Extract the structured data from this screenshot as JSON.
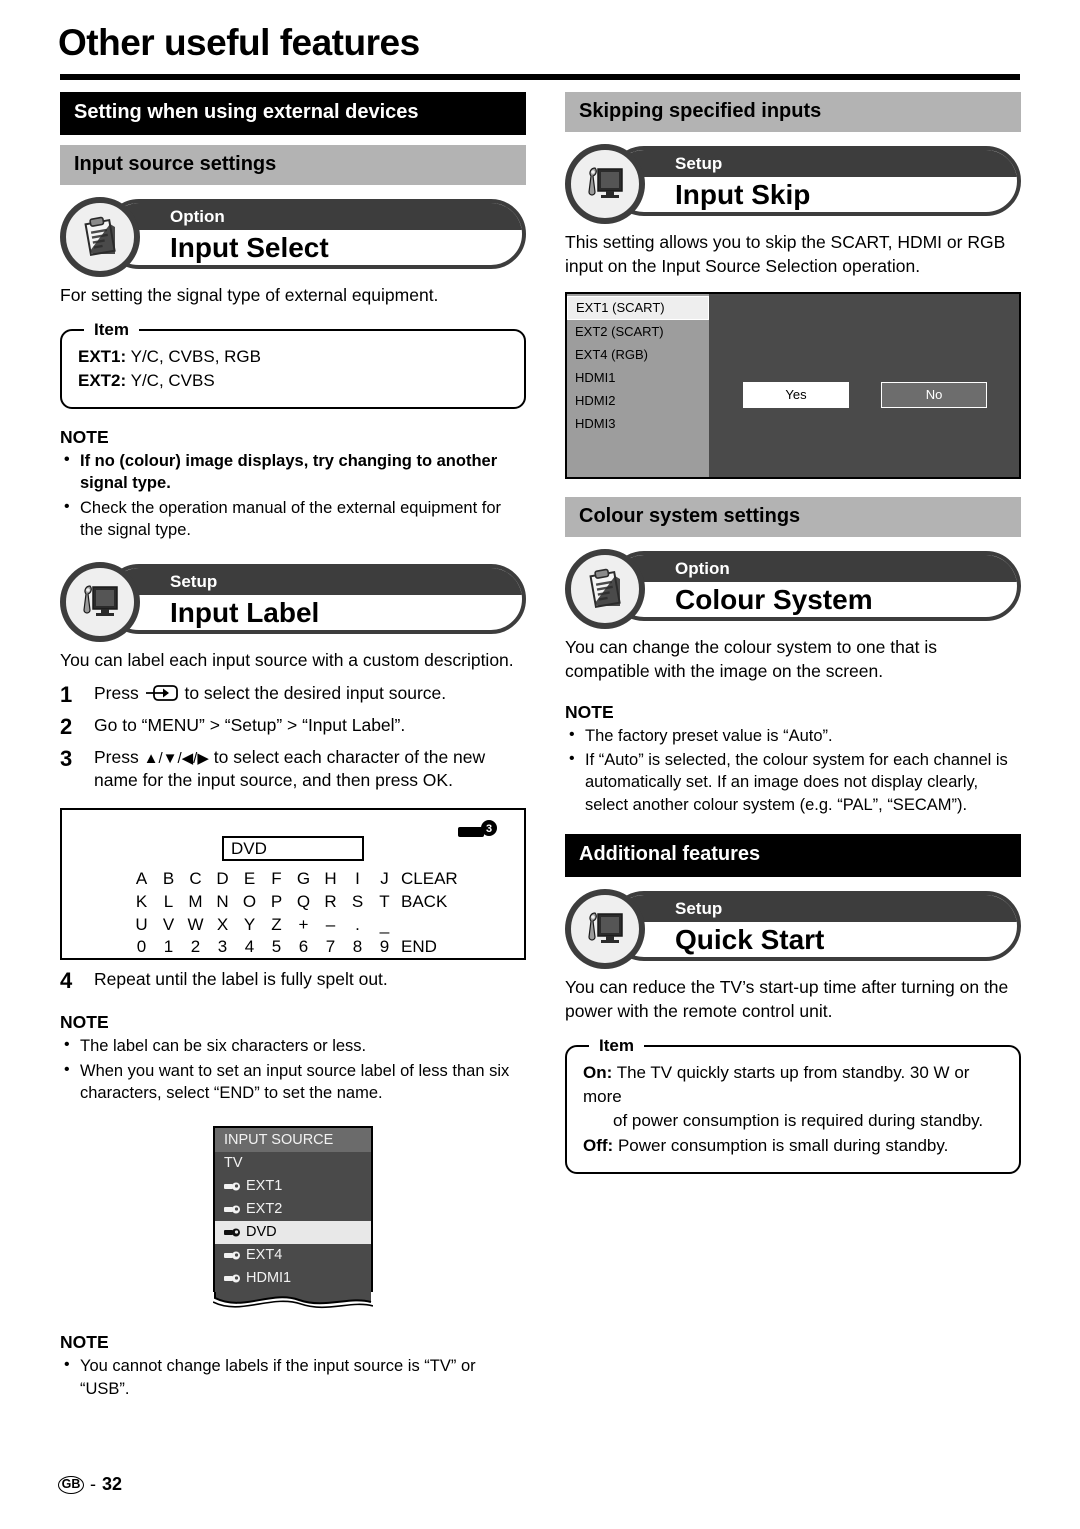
{
  "page": {
    "title": "Other useful features",
    "footer_region": "GB",
    "footer_dash": "-",
    "footer_number": "32"
  },
  "left": {
    "section_banner": "Setting when using external devices",
    "subsection_banner": "Input source settings",
    "input_select": {
      "kind": "Option",
      "name": "Input Select",
      "icon": "clipboard-icon",
      "description": "For setting the signal type of external equipment.",
      "item_label": "Item",
      "items": [
        {
          "term": "EXT1:",
          "value": "Y/C, CVBS, RGB"
        },
        {
          "term": "EXT2:",
          "value": "Y/C, CVBS"
        }
      ],
      "note_head": "NOTE",
      "notes": [
        {
          "text": "If no (colour) image displays, try changing to another signal type.",
          "bold": true
        },
        {
          "text": "Check the operation manual of the external equipment for the signal type.",
          "bold": false
        }
      ]
    },
    "input_label": {
      "kind": "Setup",
      "name": "Input Label",
      "icon": "wrench-monitor-icon",
      "description": "You can label each input source with a custom description.",
      "steps": [
        {
          "num": "1",
          "pre": "Press ",
          "icon": "input-source-button-icon",
          "post": " to select the desired input source."
        },
        {
          "num": "2",
          "pre": "Go to “MENU” > “Setup” > “Input Label”.",
          "icon": "",
          "post": ""
        },
        {
          "num": "3",
          "pre": "Press ",
          "icon": "dpad-arrows-icon",
          "post": " to select each character of the new name for the input source, and then press OK."
        },
        {
          "num": "4",
          "pre": "Repeat until the label is fully spelt out.",
          "icon": "",
          "post": ""
        }
      ],
      "char_diagram": {
        "marker": "3",
        "field_value": "DVD",
        "rows": [
          {
            "cells": [
              "A",
              "B",
              "C",
              "D",
              "E",
              "F",
              "G",
              "H",
              "I",
              "J"
            ],
            "word": "CLEAR"
          },
          {
            "cells": [
              "K",
              "L",
              "M",
              "N",
              "O",
              "P",
              "Q",
              "R",
              "S",
              "T"
            ],
            "word": "BACK"
          },
          {
            "cells": [
              "U",
              "V",
              "W",
              "X",
              "Y",
              "Z",
              "+",
              "–",
              ".",
              "_"
            ],
            "word": ""
          },
          {
            "cells": [
              "0",
              "1",
              "2",
              "3",
              "4",
              "5",
              "6",
              "7",
              "8",
              "9"
            ],
            "word": "END"
          }
        ]
      },
      "note_head": "NOTE",
      "notes": [
        {
          "text": "The label can be six characters or less."
        },
        {
          "text": "When you want to set an input source label of less than six characters, select “END” to set the name."
        }
      ],
      "source_menu": {
        "title": "INPUT SOURCE",
        "items": [
          {
            "label": "TV",
            "plug": false,
            "selected": false
          },
          {
            "label": "EXT1",
            "plug": true,
            "selected": false
          },
          {
            "label": "EXT2",
            "plug": true,
            "selected": false
          },
          {
            "label": "DVD",
            "plug": true,
            "selected": true
          },
          {
            "label": "EXT4",
            "plug": true,
            "selected": false
          },
          {
            "label": "HDMI1",
            "plug": true,
            "selected": false
          }
        ]
      },
      "note2_head": "NOTE",
      "notes2": [
        {
          "text": "You cannot change labels if the input source is “TV” or “USB”."
        }
      ]
    }
  },
  "right": {
    "skip_banner": "Skipping specified inputs",
    "input_skip": {
      "kind": "Setup",
      "name": "Input Skip",
      "icon": "wrench-monitor-icon",
      "description": "This setting allows you to skip the SCART, HDMI or RGB input on the Input Source Selection operation.",
      "screen": {
        "list": [
          {
            "label": "EXT1 (SCART)",
            "selected": true
          },
          {
            "label": "EXT2 (SCART)",
            "selected": false
          },
          {
            "label": "EXT4 (RGB)",
            "selected": false
          },
          {
            "label": "HDMI1",
            "selected": false
          },
          {
            "label": "HDMI2",
            "selected": false
          },
          {
            "label": "HDMI3",
            "selected": false
          }
        ],
        "yes_label": "Yes",
        "no_label": "No"
      }
    },
    "colour_banner": "Colour system settings",
    "colour_system": {
      "kind": "Option",
      "name": "Colour System",
      "icon": "clipboard-icon",
      "description": "You can change the colour system to one that is compatible with the image on the screen.",
      "note_head": "NOTE",
      "notes": [
        {
          "text": "The factory preset value is “Auto”."
        },
        {
          "text": "If “Auto” is selected, the colour system for each channel is automatically set. If an image does not display clearly, select another colour system (e.g. “PAL”, “SECAM”)."
        }
      ]
    },
    "additional_banner": "Additional features",
    "quick_start": {
      "kind": "Setup",
      "name": "Quick Start",
      "icon": "wrench-monitor-icon",
      "description": "You can reduce the TV’s start-up time after turning on the power with the remote control unit.",
      "item_label": "Item",
      "items": [
        {
          "term": "On:",
          "value": "The TV quickly starts up from standby. 30 W or more"
        },
        {
          "term": "",
          "value": "of power consumption is required during standby."
        },
        {
          "term": "Off:",
          "value": "Power consumption is small during standby."
        }
      ]
    }
  },
  "colors": {
    "banner_black": "#000000",
    "banner_gray": "#b3b3b3",
    "badge_dark": "#3d3d3d",
    "screen_dark": "#4a4a4a",
    "screen_list": "#9d9d9d"
  }
}
